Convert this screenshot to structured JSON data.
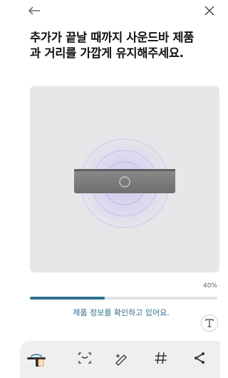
{
  "header": {
    "back_icon": "arrow-left-icon",
    "close_icon": "close-icon"
  },
  "title": {
    "line1": "추가가 끝날 때까지 사운드바 제품",
    "line2": "과 거리를 가깝게 유지해주세요."
  },
  "illustration": {
    "device": "soundbar",
    "effect": "radio-waves"
  },
  "progress": {
    "percent_label": "40%",
    "fraction": 0.4,
    "fill_color": "#2a6f8c"
  },
  "status_text": "제품 정보를 확인하고 있어요.",
  "text_size_icon": "text-size-icon",
  "toolbar": {
    "items": [
      "screen-capture-icon",
      "smart-select-icon",
      "draw-icon",
      "hashtag-icon",
      "share-icon"
    ]
  },
  "colors": {
    "accent": "#2d6f8b",
    "illustration_bg": "#e7e7e9"
  }
}
